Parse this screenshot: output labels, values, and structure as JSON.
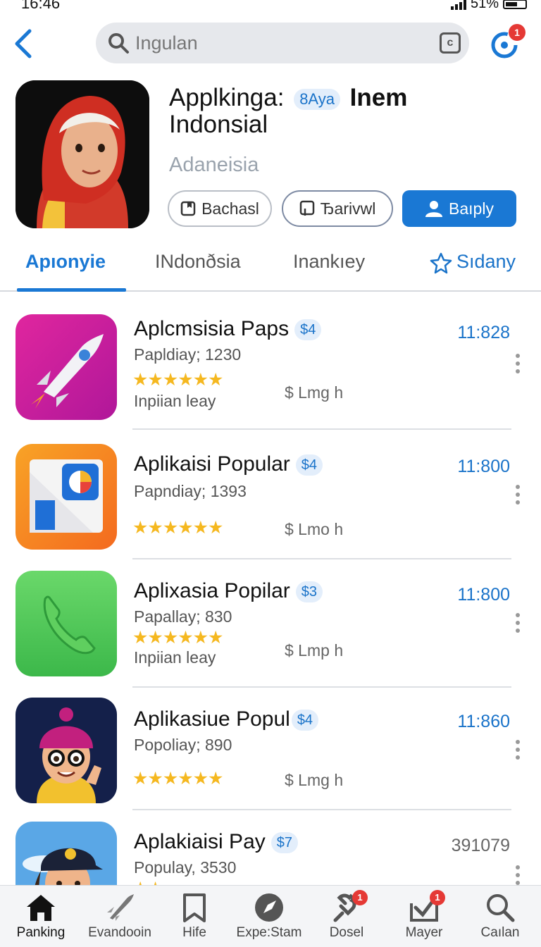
{
  "status_bar": {
    "time": "16:46",
    "battery": "51%"
  },
  "search": {
    "placeholder": "Ingulan"
  },
  "update_badge": "1",
  "app": {
    "title_part1": "Applkinga:",
    "title_pill": "8Aya",
    "title_part2": "Inem",
    "title_line2": "Indonsial",
    "subtitle": "Adaneisia",
    "buttons": {
      "outline1": "Bachasl",
      "outline2": "Ђarivwl",
      "primary": "Baıply"
    }
  },
  "tabs": [
    "Apıonyie",
    "INdonðsia",
    "Inankıey",
    "Sıdany"
  ],
  "apps": [
    {
      "name": "Aplcmsisia Paps",
      "price": "$4",
      "popularity": "Papldiay; 1230",
      "rating": "★★★★★★",
      "tag": "Inpiian leay",
      "meta": "$ Lmg h",
      "time": "11:828",
      "time_style": "blue"
    },
    {
      "name": "Aplikaisi Popular",
      "price": "$4",
      "popularity": "Papndiay; 1393",
      "rating": "★★★★★★",
      "tag": "",
      "meta": "$ Lmo h",
      "time": "11:800",
      "time_style": "blue"
    },
    {
      "name": "Aplixasia Popilar",
      "price": "$3",
      "popularity": "Papallay; 830",
      "rating": "★★★★★★",
      "tag": "Inpiian leay",
      "meta": "$ Lmp h",
      "time": "11:800",
      "time_style": "blue"
    },
    {
      "name": "Aplikasiue Popul",
      "price": "$4",
      "popularity": "Popoliay; 890",
      "rating": "★★★★★★",
      "tag": "",
      "meta": "$ Lmg h",
      "time": "11:860",
      "time_style": "blue"
    },
    {
      "name": "Aplakiaisi Pay",
      "price": "$7",
      "popularity": "Populay, 3530",
      "rating": "★★",
      "tag": "",
      "meta": "",
      "time": "391079",
      "time_style": "gray"
    }
  ],
  "bottom_nav": [
    {
      "label": "Panking",
      "icon": "home-icon"
    },
    {
      "label": "Evandooin",
      "icon": "rocket-icon"
    },
    {
      "label": "Hife",
      "icon": "bookmark-icon"
    },
    {
      "label": "Expe:Stam",
      "icon": "explore-icon",
      "badge": ""
    },
    {
      "label": "Dosel",
      "icon": "plug-icon",
      "badge": "1"
    },
    {
      "label": "Mayer",
      "icon": "inbox-icon",
      "badge": "1"
    },
    {
      "label": "Caılan",
      "icon": "search-icon"
    }
  ],
  "colors": {
    "accent": "#1a78d4",
    "star": "#f5b820",
    "badge": "#e53935"
  }
}
